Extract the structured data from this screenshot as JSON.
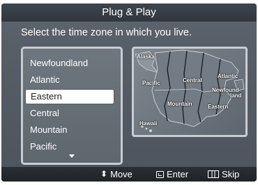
{
  "title": "Plug & Play",
  "instruction": "Select the time zone in which you live.",
  "timezones": {
    "items": [
      {
        "label": "Newfoundland"
      },
      {
        "label": "Atlantic"
      },
      {
        "label": "Eastern"
      },
      {
        "label": "Central"
      },
      {
        "label": "Mountain"
      },
      {
        "label": "Pacific"
      }
    ],
    "selected": "Eastern"
  },
  "map": {
    "labels": {
      "alaska": "Alaska",
      "pacific": "Pacific",
      "central": "Central",
      "atlantic": "Atlantic",
      "newfoundland_1": "Newfound-",
      "newfoundland_2": "land",
      "mountain": "Mountain",
      "eastern": "Eastern",
      "hawaii": "Hawaii"
    }
  },
  "footer": {
    "move": "Move",
    "enter": "Enter",
    "skip": "Skip"
  },
  "icons": {
    "move": "up-down-arrows-icon",
    "enter": "enter-icon",
    "skip": "skip-icon",
    "scroll": "scroll-down-icon"
  },
  "colors": {
    "panel_bg": "#575f68",
    "title_bg": "#30363d",
    "selection_bg": "#ffffff",
    "text": "#ffffff"
  }
}
